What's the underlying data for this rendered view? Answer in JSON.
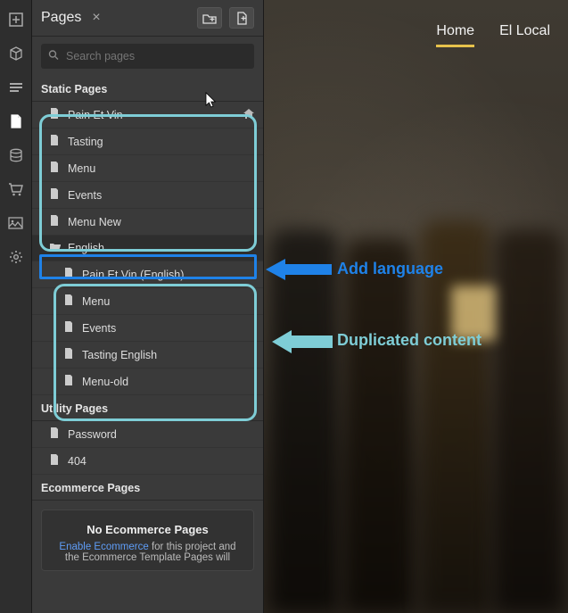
{
  "panel": {
    "title": "Pages",
    "search_placeholder": "Search pages"
  },
  "sections": {
    "static": "Static Pages",
    "utility": "Utility Pages",
    "ecommerce": "Ecommerce Pages"
  },
  "static_pages": {
    "p0": "Pain Et Vin",
    "p1": "Tasting",
    "p2": "Menu",
    "p3": "Events",
    "p4": "Menu New",
    "folder": "English",
    "c0": "Pain Et Vin (English)",
    "c1": "Menu",
    "c2": "Events",
    "c3": "Tasting English",
    "c4": "Menu-old"
  },
  "utility_pages": {
    "u0": "Password",
    "u1": "404"
  },
  "ecommerce": {
    "title": "No Ecommerce Pages",
    "link": "Enable Ecommerce",
    "text1": " for this project and the Ecommerce Template Pages will"
  },
  "nav": {
    "home": "Home",
    "ellocal": "El Local"
  },
  "annotations": {
    "add_language": "Add language",
    "duplicated": "Duplicated content"
  },
  "colors": {
    "highlight_cyan": "#7ecdd6",
    "highlight_blue": "#1f82e8",
    "nav_underline": "#e7c24b"
  }
}
